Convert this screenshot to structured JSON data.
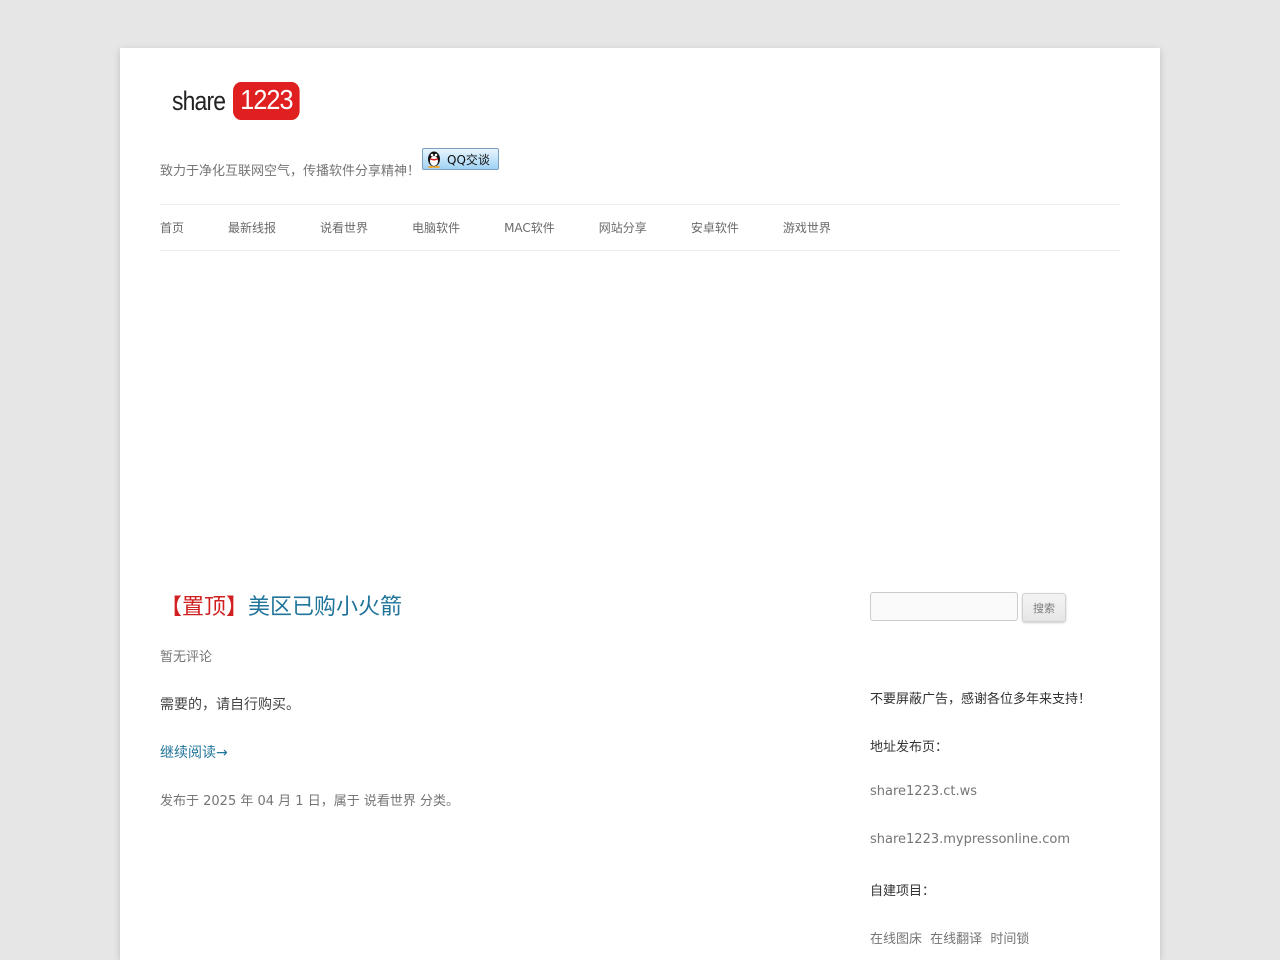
{
  "site": {
    "logo_word": "share",
    "logo_number": "1223",
    "tagline": "致力于净化互联网空气，传播软件分享精神！",
    "qq_button_label": "QQ交谈"
  },
  "nav": {
    "items": [
      "首页",
      "最新线报",
      "说看世界",
      "电脑软件",
      "MAC软件",
      "网站分享",
      "安卓软件",
      "游戏世界"
    ]
  },
  "post": {
    "sticky_label": "【置顶】",
    "title": "美区已购小火箭",
    "comments": "暂无评论",
    "excerpt": "需要的，请自行购买。",
    "read_more": "继续阅读→",
    "footer": "发布于 2025 年 04 月 1 日，属于 说看世界 分类。"
  },
  "sidebar": {
    "search_placeholder": "",
    "search_button": "搜索",
    "notice": "不要屏蔽广告，感谢各位多年来支持！",
    "address_heading": "地址发布页：",
    "address_1": "share1223.ct.ws",
    "address_2": "share1223.mypressonline.com",
    "projects_heading": "自建项目：",
    "projects": [
      "在线图床",
      "在线翻译",
      "时间锁"
    ]
  },
  "colors": {
    "background": "#e6e6e6",
    "link": "#21759b",
    "sticky": "#d12020",
    "logo_red": "#e02020"
  }
}
